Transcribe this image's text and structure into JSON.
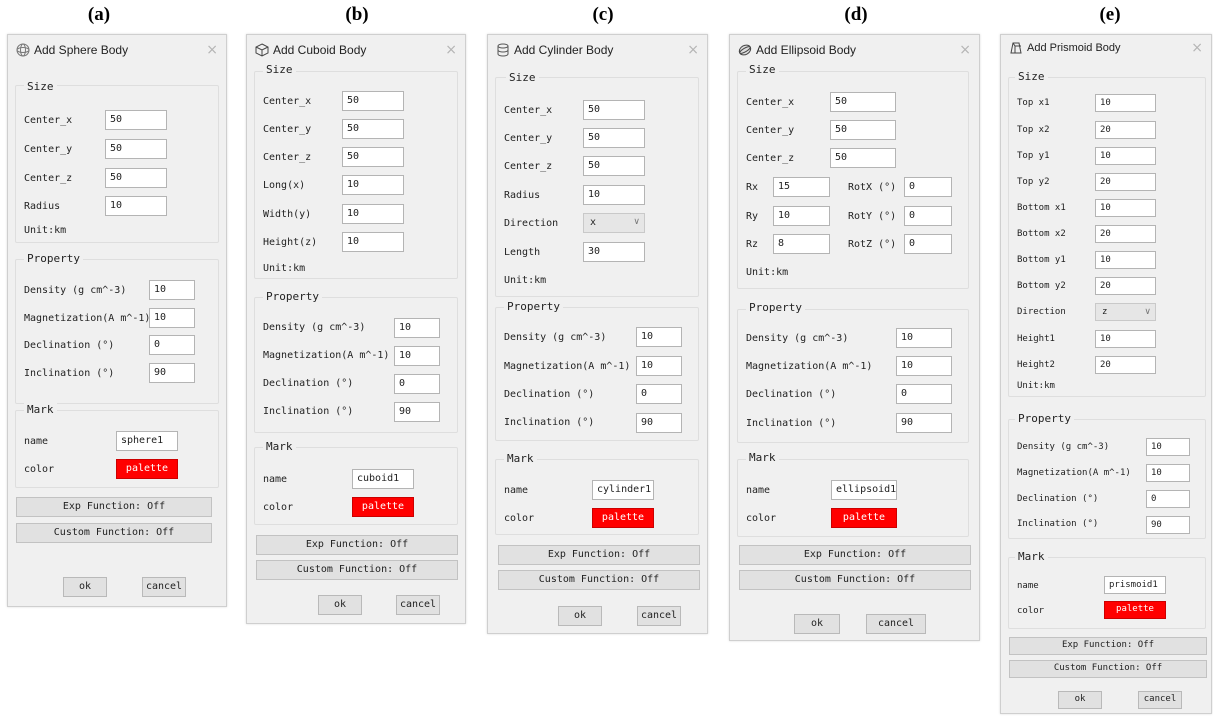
{
  "colors": {
    "palette_red": "#ff0000",
    "dialog_bg": "#f0f0f0"
  },
  "common": {
    "close": "×",
    "size": "Size",
    "property": "Property",
    "mark": "Mark",
    "unit": "Unit:km",
    "density": "Density (g cm^-3)",
    "magnetization": "Magnetization(A m^-1)",
    "declination": "Declination (°)",
    "inclination": "Inclination (°)",
    "name": "name",
    "color": "color",
    "palette": "palette",
    "exp_function": "Exp Function: Off",
    "custom_function": "Custom Function: Off",
    "ok": "ok",
    "cancel": "cancel"
  },
  "dialogs": {
    "a": {
      "label": "(a)",
      "title": "Add Sphere Body",
      "icon": "sphere-icon",
      "fields": [
        {
          "label": "Center_x",
          "value": "50"
        },
        {
          "label": "Center_y",
          "value": "50"
        },
        {
          "label": "Center_z",
          "value": "50"
        },
        {
          "label": "Radius",
          "value": "10"
        }
      ],
      "property": [
        "10",
        "10",
        "0",
        "90"
      ],
      "mark_name": "sphere1"
    },
    "b": {
      "label": "(b)",
      "title": "Add Cuboid Body",
      "icon": "cuboid-icon",
      "fields": [
        {
          "label": "Center_x",
          "value": "50"
        },
        {
          "label": "Center_y",
          "value": "50"
        },
        {
          "label": "Center_z",
          "value": "50"
        },
        {
          "label": "Long(x)",
          "value": "10"
        },
        {
          "label": "Width(y)",
          "value": "10"
        },
        {
          "label": "Height(z)",
          "value": "10"
        }
      ],
      "property": [
        "10",
        "10",
        "0",
        "90"
      ],
      "mark_name": "cuboid1"
    },
    "c": {
      "label": "(c)",
      "title": "Add Cylinder Body",
      "icon": "cylinder-icon",
      "fields": [
        {
          "label": "Center_x",
          "value": "50"
        },
        {
          "label": "Center_y",
          "value": "50"
        },
        {
          "label": "Center_z",
          "value": "50"
        },
        {
          "label": "Radius",
          "value": "10"
        }
      ],
      "direction_label": "Direction",
      "direction_value": "x",
      "length_label": "Length",
      "length_value": "30",
      "property": [
        "10",
        "10",
        "0",
        "90"
      ],
      "mark_name": "cylinder1"
    },
    "d": {
      "label": "(d)",
      "title": "Add Ellipsoid Body",
      "icon": "ellipsoid-icon",
      "fields": [
        {
          "label": "Center_x",
          "value": "50"
        },
        {
          "label": "Center_y",
          "value": "50"
        },
        {
          "label": "Center_z",
          "value": "50"
        }
      ],
      "radii": [
        {
          "label": "Rx",
          "value": "15",
          "rot_label": "RotX (°)",
          "rot_value": "0"
        },
        {
          "label": "Ry",
          "value": "10",
          "rot_label": "RotY (°)",
          "rot_value": "0"
        },
        {
          "label": "Rz",
          "value": "8",
          "rot_label": "RotZ (°)",
          "rot_value": "0"
        }
      ],
      "property": [
        "10",
        "10",
        "0",
        "90"
      ],
      "mark_name": "ellipsoid1"
    },
    "e": {
      "label": "(e)",
      "title": "Add Prismoid Body",
      "icon": "prismoid-icon",
      "fields": [
        {
          "label": "Top x1",
          "value": "10"
        },
        {
          "label": "Top x2",
          "value": "20"
        },
        {
          "label": "Top y1",
          "value": "10"
        },
        {
          "label": "Top y2",
          "value": "20"
        },
        {
          "label": "Bottom x1",
          "value": "10"
        },
        {
          "label": "Bottom x2",
          "value": "20"
        },
        {
          "label": "Bottom y1",
          "value": "10"
        },
        {
          "label": "Bottom y2",
          "value": "20"
        }
      ],
      "direction_label": "Direction",
      "direction_value": "z",
      "heights": [
        {
          "label": "Height1",
          "value": "10"
        },
        {
          "label": "Height2",
          "value": "20"
        }
      ],
      "property": [
        "10",
        "10",
        "0",
        "90"
      ],
      "mark_name": "prismoid1"
    }
  }
}
